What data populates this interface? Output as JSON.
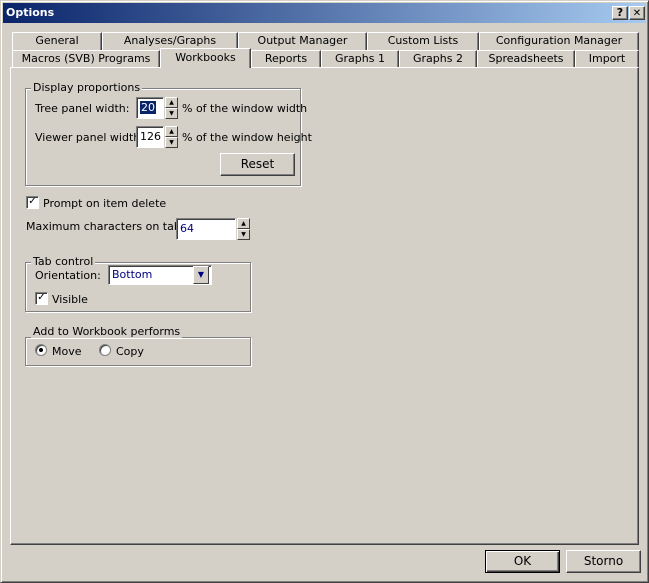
{
  "window": {
    "title": "Options",
    "help_label": "?",
    "close_label": "✕"
  },
  "tabs_row1": [
    {
      "label": "General"
    },
    {
      "label": "Analyses/Graphs"
    },
    {
      "label": "Output Manager"
    },
    {
      "label": "Custom Lists"
    },
    {
      "label": "Configuration Manager"
    }
  ],
  "tabs_row2": [
    {
      "label": "Macros (SVB) Programs"
    },
    {
      "label": "Workbooks"
    },
    {
      "label": "Reports"
    },
    {
      "label": "Graphs 1"
    },
    {
      "label": "Graphs 2"
    },
    {
      "label": "Spreadsheets"
    },
    {
      "label": "Import"
    }
  ],
  "display_proportions": {
    "legend": "Display proportions",
    "tree_label": "Tree panel width:",
    "tree_value": "20",
    "tree_suffix": "% of the window width",
    "viewer_label": "Viewer panel width:",
    "viewer_value": "126",
    "viewer_suffix": "% of the window height",
    "reset_label": "Reset"
  },
  "prompt_delete": {
    "label": "Prompt on item delete",
    "checked": true
  },
  "max_chars": {
    "label": "Maximum characters on tabs:",
    "value": "64"
  },
  "tab_control": {
    "legend": "Tab control",
    "orientation_label": "Orientation:",
    "orientation_value": "Bottom",
    "visible_label": "Visible",
    "visible_checked": true
  },
  "add_workbook": {
    "legend": "Add to Workbook performs",
    "move_label": "Move",
    "copy_label": "Copy",
    "selected": "Move"
  },
  "footer": {
    "ok_label": "OK",
    "cancel_label": "Storno"
  },
  "icons": {
    "spin_up": "▲",
    "spin_down": "▼",
    "dropdown": "▼",
    "check": "✓"
  }
}
